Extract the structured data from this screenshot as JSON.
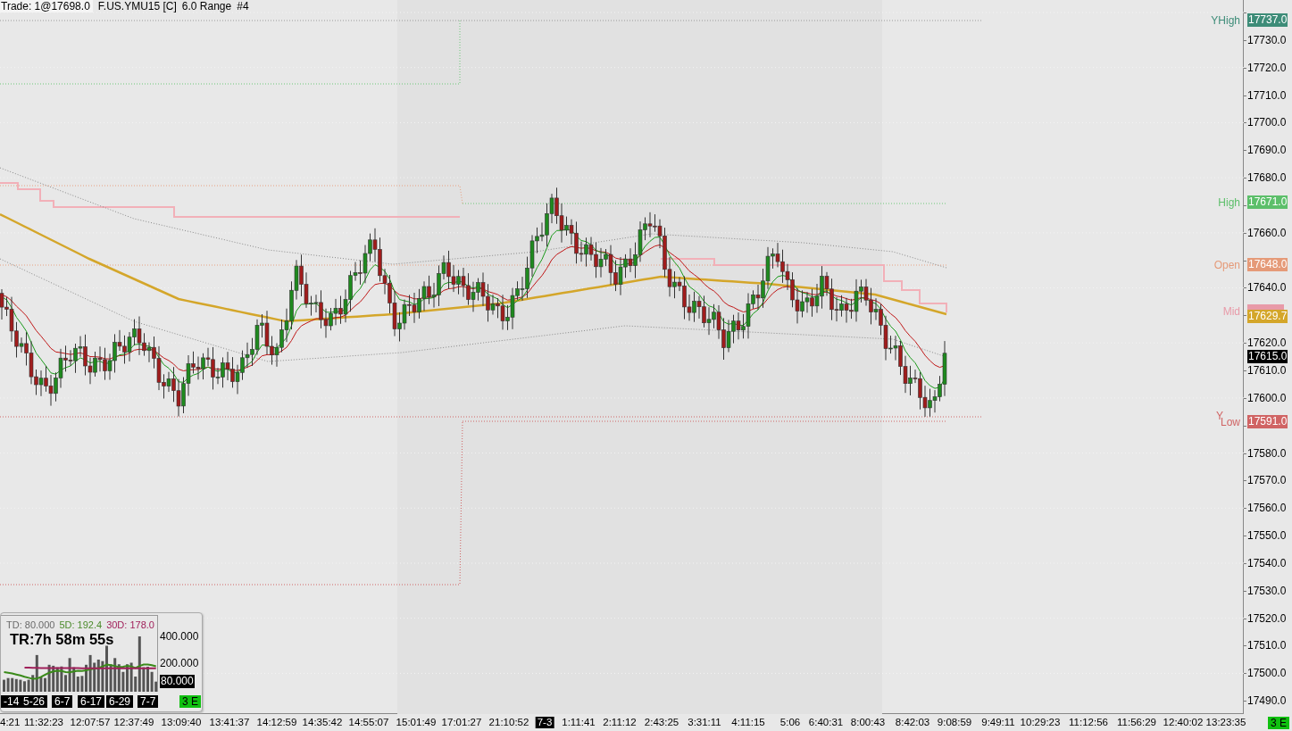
{
  "header": {
    "trade": "Trade: 1@17698.0",
    "symbol": "F.US.YMU15 [C]",
    "bar_type": "6.0 Range",
    "chart_number": "#4"
  },
  "price_axis": {
    "ticks": [
      "17730.0",
      "17720.0",
      "17710.0",
      "17700.0",
      "17690.0",
      "17680.0",
      "17660.0",
      "17640.0",
      "17620.0",
      "17610.0",
      "17600.0",
      "17580.0",
      "17570.0",
      "17560.0",
      "17550.0",
      "17540.0",
      "17530.0",
      "17520.0",
      "17510.0",
      "17500.0",
      "17490.0"
    ]
  },
  "levels": [
    {
      "label": "YHigh",
      "value": "17737.0",
      "color": "#3d8c78"
    },
    {
      "label": "High",
      "value": "17671.0",
      "color": "#5cbf6a"
    },
    {
      "label": "Open",
      "value": "17648.0",
      "color": "#e59a78"
    },
    {
      "label": "Mid",
      "color": "#e89aa8"
    },
    {
      "label": "Low",
      "prefix": "Y",
      "value": "17591.0",
      "color": "#d06464"
    }
  ],
  "indicator_tags": [
    {
      "value": "17629.7",
      "color": "#d4a62a"
    },
    {
      "value": "17615.0",
      "color": "#000000"
    }
  ],
  "time_axis": {
    "labels": [
      {
        "text": "4:21",
        "kind": "time"
      },
      {
        "text": "11:32:23",
        "kind": "time"
      },
      {
        "text": "12:07:57",
        "kind": "time"
      },
      {
        "text": "12:37:49",
        "kind": "time"
      },
      {
        "text": "13:09:40",
        "kind": "time"
      },
      {
        "text": "13:41:37",
        "kind": "time"
      },
      {
        "text": "14:12:59",
        "kind": "time"
      },
      {
        "text": "14:35:42",
        "kind": "time"
      },
      {
        "text": "14:55:07",
        "kind": "time"
      },
      {
        "text": "15:01:49",
        "kind": "time"
      },
      {
        "text": "17:01:27",
        "kind": "time"
      },
      {
        "text": "21:10:52",
        "kind": "time"
      },
      {
        "text": "7-3",
        "kind": "date"
      },
      {
        "text": "1:11:41",
        "kind": "time"
      },
      {
        "text": "2:11:12",
        "kind": "time"
      },
      {
        "text": "2:43:25",
        "kind": "time"
      },
      {
        "text": "3:31:11",
        "kind": "time"
      },
      {
        "text": "4:11:15",
        "kind": "time"
      },
      {
        "text": "5:06",
        "kind": "time"
      },
      {
        "text": "6:40:31",
        "kind": "time"
      },
      {
        "text": "8:00:43",
        "kind": "time"
      },
      {
        "text": "8:42:03",
        "kind": "time"
      },
      {
        "text": "9:08:59",
        "kind": "time"
      },
      {
        "text": "9:49:11",
        "kind": "time"
      },
      {
        "text": "10:29:23",
        "kind": "time"
      },
      {
        "text": "11:12:56",
        "kind": "time"
      },
      {
        "text": "11:56:29",
        "kind": "time"
      },
      {
        "text": "12:40:02",
        "kind": "time"
      },
      {
        "text": "13:23:35",
        "kind": "time"
      }
    ]
  },
  "status_badge": "3 E",
  "inset": {
    "stats": [
      {
        "text": "TD: 80.000",
        "color": "#6a6a6a"
      },
      {
        "text": "5D: 192.4",
        "color": "#4a8a2a"
      },
      {
        "text": "30D: 178.0",
        "color": "#a0205a"
      }
    ],
    "timer": "TR:7h 58m 55s",
    "chart_data": {
      "type": "bar",
      "ylim": [
        0,
        560
      ],
      "yticks": [
        {
          "value": 200,
          "label": "200.000"
        },
        {
          "value": 400,
          "label": "400.000"
        }
      ],
      "series": [
        {
          "type": "bar",
          "color": "#555555",
          "values": [
            94,
            106,
            106,
            99,
            94,
            83,
            94,
            128,
            274,
            117,
            106,
            203,
            196,
            185,
            191,
            128,
            252,
            185,
            117,
            122,
            203,
            274,
            218,
            241,
            230,
            342,
            207,
            252,
            207,
            151,
            207,
            218,
            117,
            410,
            185,
            189,
            151,
            80
          ]
        },
        {
          "type": "line",
          "color": "#3a8a1a",
          "values": [
            150,
            145,
            140,
            132,
            125,
            115,
            108,
            100,
            102,
            115,
            130,
            145,
            155,
            160,
            158,
            150,
            148,
            155,
            160,
            158,
            162,
            170,
            175,
            180,
            190,
            205,
            200,
            195,
            185,
            188,
            195,
            190,
            180,
            195,
            205,
            205,
            200,
            192
          ]
        },
        {
          "type": "line",
          "color": "#a0205a",
          "values": [
            null,
            null,
            null,
            null,
            null,
            182,
            182,
            181,
            181,
            180,
            180,
            180,
            180,
            180,
            179,
            179,
            179,
            179,
            179,
            178,
            178,
            178,
            178,
            178,
            178,
            178,
            178,
            178,
            178,
            178,
            178,
            178,
            178,
            178,
            178,
            178,
            178,
            178
          ]
        }
      ]
    },
    "current_label": "80.000",
    "date_tags": [
      "-14",
      "5-26",
      "6-7",
      "6-17",
      "6-29",
      "7-7"
    ],
    "badge": "3 E"
  }
}
